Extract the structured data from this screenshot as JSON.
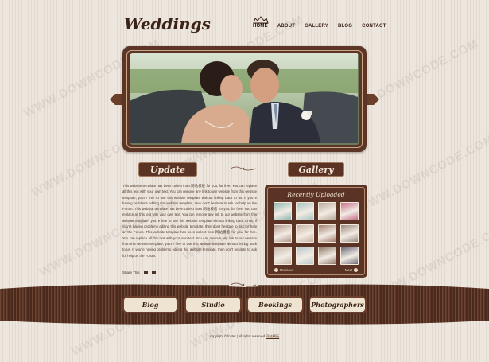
{
  "header": {
    "logo": "Weddings",
    "nav": [
      "HOME",
      "ABOUT",
      "GALLERY",
      "BLOG",
      "CONTACT"
    ]
  },
  "update": {
    "title": "Update",
    "paragraph": "This website template has been collect from 网站模板 for you, for free. You can replace all this text with your own text. You can remove any link to our website from this website template, you're free to use this website template without linking back to us. If you're having problems editing this website template, then don't hesitate to ask for help on the Forum. This website template has been collect from 网站模板 for you, for free. You can replace all this text with your own text. You can remove any link to our website from this website template, you're free to use this website template without linking back to us. If you're having problems editing this website template, then don't hesitate to ask for help on the Forum. This website template has been collect from 网站模板 for you, for free. You can replace all this text with your own text. You can remove any link to our website from this website template, you're free to use this website template without linking back to us. If you're having problems editing this website template, then don't hesitate to ask for help on the Forum.",
    "share_label": "Share This"
  },
  "gallery": {
    "title": "Gallery",
    "box_title": "Recently Uploaded",
    "prev": "Previous",
    "next": "Next",
    "thumb_colors": [
      "#8fb8b0",
      "#a6c5c0",
      "#b9a89a",
      "#c66f8a",
      "#b19a8f",
      "#c9b2a4",
      "#a47f70",
      "#9a8a7e",
      "#c7b8a9",
      "#b9c8cc",
      "#8f7a6a",
      "#6c6a78"
    ]
  },
  "footer": {
    "buttons": [
      "Blog",
      "Studio",
      "Bookings",
      "Photographers"
    ],
    "copyright": "copyright © foster | all rights reserved",
    "copyright_link": "网站模板"
  },
  "colors": {
    "brown_dark": "#5a3324",
    "cream": "#efe3d2",
    "background": "#ebe4dc"
  }
}
